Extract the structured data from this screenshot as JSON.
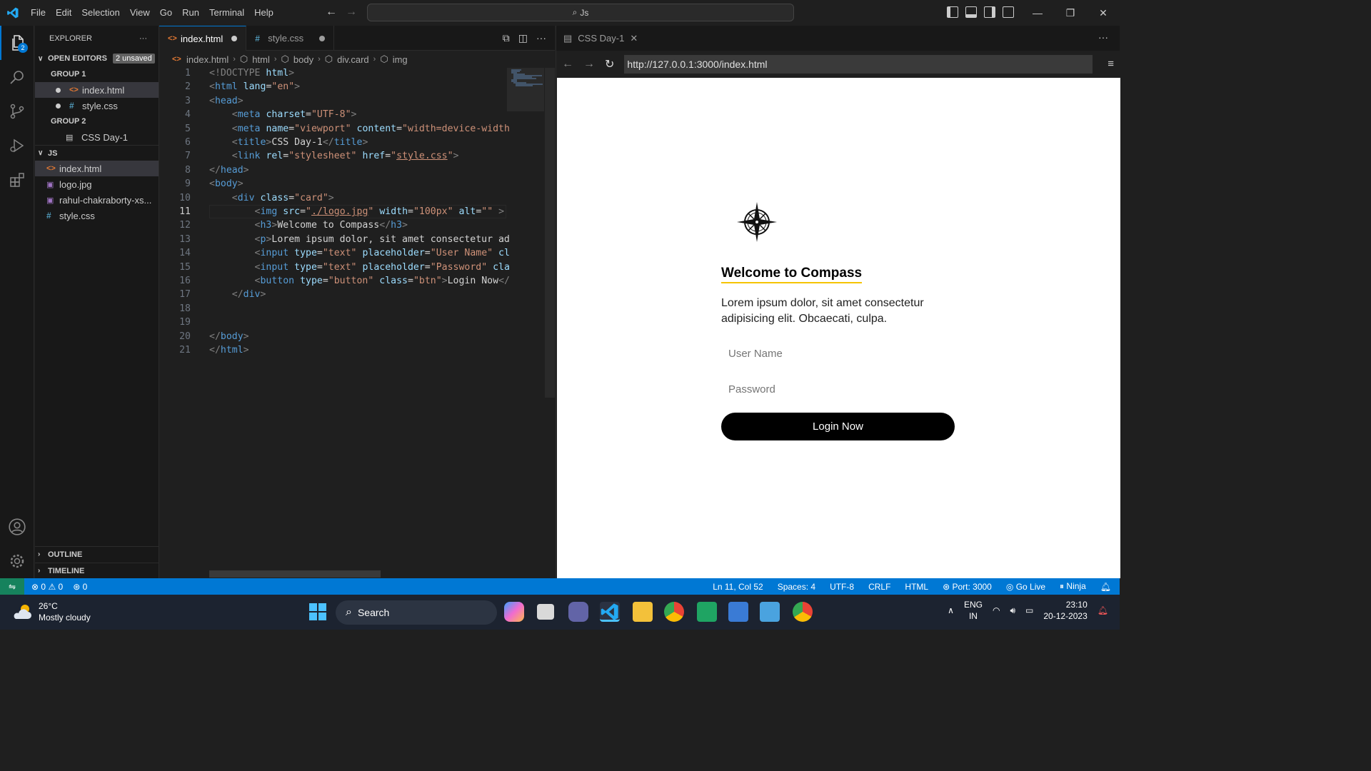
{
  "titlebar": {
    "menu": [
      "File",
      "Edit",
      "Selection",
      "View",
      "Go",
      "Run",
      "Terminal",
      "Help"
    ],
    "command_center": "Js"
  },
  "activity_badge": "2",
  "sidebar": {
    "title": "EXPLORER",
    "more": "···",
    "open_editors_label": "OPEN EDITORS",
    "unsaved_badge": "2 unsaved",
    "group1_label": "GROUP 1",
    "group1_files": [
      "index.html",
      "style.css"
    ],
    "group2_label": "GROUP 2",
    "group2_files": [
      "CSS Day-1"
    ],
    "folder_label": "JS",
    "files": [
      "index.html",
      "logo.jpg",
      "rahul-chakraborty-xs...",
      "style.css"
    ],
    "outline_label": "OUTLINE",
    "timeline_label": "TIMELINE"
  },
  "editor": {
    "tabs": [
      "index.html",
      "style.css"
    ],
    "breadcrumbs": [
      "index.html",
      "html",
      "body",
      "div.card",
      "img"
    ],
    "line_numbers": [
      "1",
      "2",
      "3",
      "4",
      "5",
      "6",
      "7",
      "8",
      "9",
      "10",
      "11",
      "12",
      "13",
      "14",
      "15",
      "16",
      "17",
      "18",
      "19",
      "20",
      "21"
    ],
    "current_line": "11"
  },
  "preview": {
    "tab_title": "CSS Day-1",
    "url": "http://127.0.0.1:3000/index.html",
    "heading": "Welcome to Compass",
    "paragraph": "Lorem ipsum dolor, sit amet consectetur adipisicing elit. Obcaecati, culpa.",
    "username_placeholder": "User Name",
    "password_placeholder": "Password",
    "button_label": "Login Now"
  },
  "status": {
    "errors": "0",
    "warnings": "0",
    "ports": "0",
    "cursor": "Ln 11, Col 52",
    "spaces": "Spaces: 4",
    "encoding": "UTF-8",
    "eol": "CRLF",
    "language": "HTML",
    "port": "Port: 3000",
    "golive": "Go Live",
    "ninja": "Ninja"
  },
  "taskbar": {
    "temperature": "26°C",
    "weather": "Mostly cloudy",
    "search_label": "Search",
    "lang": "ENG",
    "region": "IN",
    "time": "23:10",
    "date": "20-12-2023"
  },
  "colors": {
    "accent": "#0078d4",
    "statusbar": "#0078d4",
    "remote": "#16825d",
    "heading_underline": "#f5c400"
  }
}
